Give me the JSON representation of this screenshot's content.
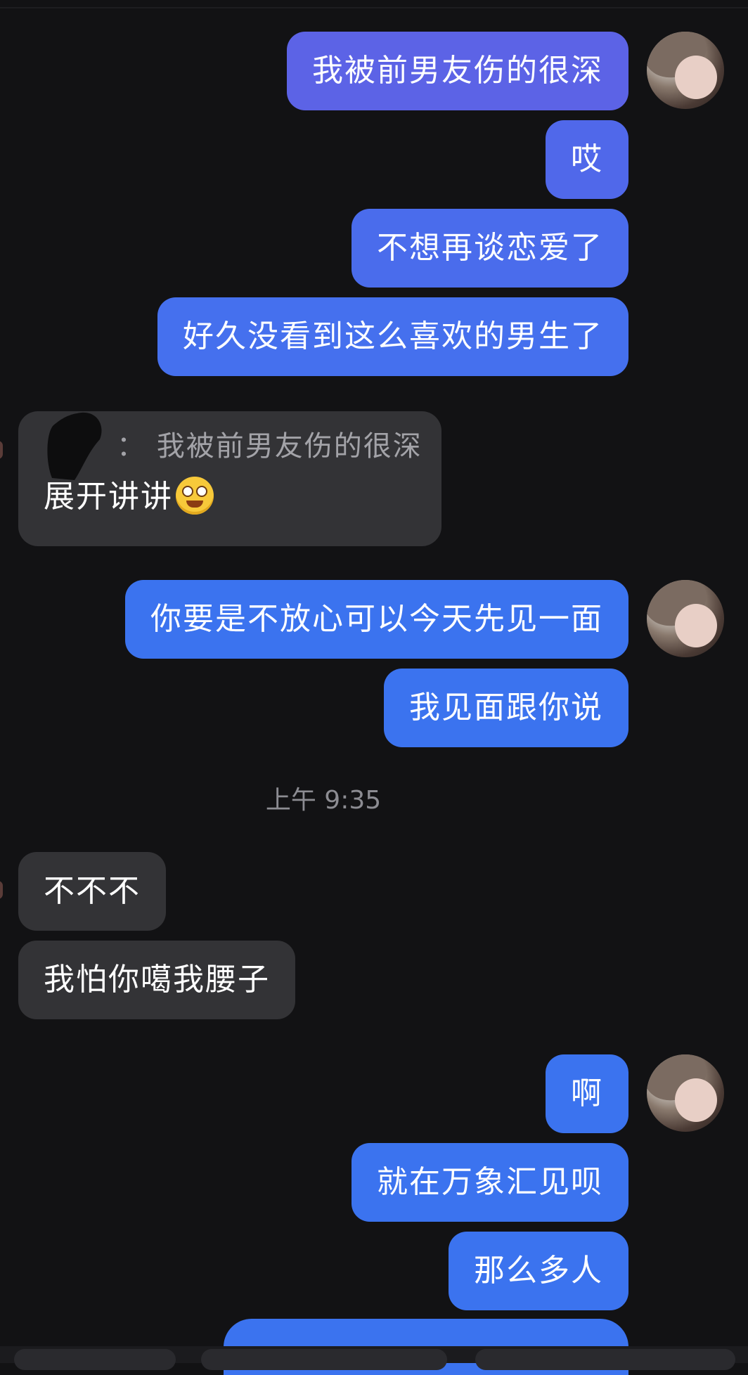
{
  "colors": {
    "background": "#121214",
    "incoming_bubble": "#333336",
    "outgoing_gradient_start": "#5c63e6",
    "outgoing_blue": "#3b73ef",
    "text": "#ffffff",
    "timestamp": "#8c8c92"
  },
  "chat": {
    "group1": [
      {
        "text": "我被前男友伤的很深"
      },
      {
        "text": "哎"
      },
      {
        "text": "不想再谈恋爱了"
      },
      {
        "text": "好久没看到这么喜欢的男生了"
      }
    ],
    "quote": {
      "separator": "：",
      "quoted_text": "我被前男友伤的很深",
      "reply_text": "展开讲讲",
      "emoji": "grinning-emoji"
    },
    "group2": [
      {
        "text": "你要是不放心可以今天先见一面"
      },
      {
        "text": "我见面跟你说"
      }
    ],
    "timestamp": "上午 9:35",
    "incoming2": [
      {
        "text": "不不不"
      },
      {
        "text": "我怕你噶我腰子"
      }
    ],
    "group3": [
      {
        "text": "啊"
      },
      {
        "text": "就在万象汇见呗"
      },
      {
        "text": "那么多人"
      }
    ]
  }
}
